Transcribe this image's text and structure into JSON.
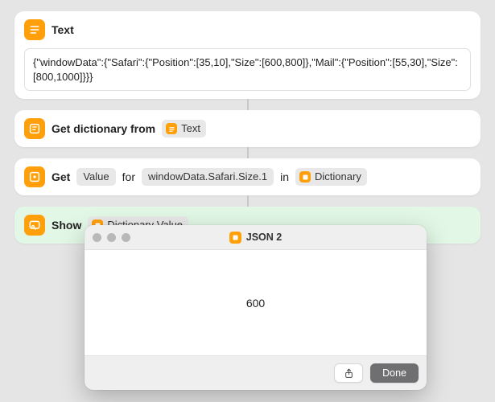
{
  "actions": {
    "text": {
      "title": "Text",
      "content": "{\"windowData\":{\"Safari\":{\"Position\":[35,10],\"Size\":[600,800]},\"Mail\":{\"Position\":[55,30],\"Size\":[800,1000]}}}"
    },
    "getDictionary": {
      "title": "Get dictionary from",
      "input_token": "Text"
    },
    "getValue": {
      "verb": "Get",
      "param_label": "Value",
      "for_word": "for",
      "keypath": "windowData.Safari.Size.1",
      "in_word": "in",
      "source_token": "Dictionary"
    },
    "show": {
      "title": "Show",
      "input_token": "Dictionary Value"
    }
  },
  "result_window": {
    "title": "JSON 2",
    "value": "600",
    "done_label": "Done"
  }
}
